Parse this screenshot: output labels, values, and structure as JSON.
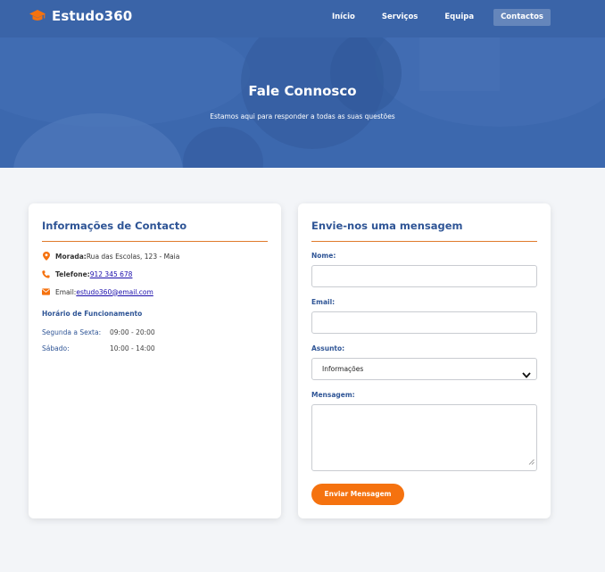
{
  "brand": {
    "name": "Estudo360",
    "icon": "graduation-cap-icon",
    "icon_color": "#f5720f"
  },
  "nav": {
    "items": [
      {
        "label": "Início"
      },
      {
        "label": "Serviços"
      },
      {
        "label": "Equipa"
      },
      {
        "label": "Contactos",
        "active": true
      }
    ]
  },
  "hero": {
    "title": "Fale Connosco",
    "subtitle": "Estamos aqui para responder a todas as suas questões"
  },
  "contact_info": {
    "title": "Informações de Contacto",
    "address_label": "Morada:",
    "address_value": "Rua das Escolas, 123 - Maia",
    "phone_label": "Telefone:",
    "phone_value": "912 345 678",
    "email_label": "Email:",
    "email_value": "estudo360@email.com",
    "hours_title": "Horário de Funcionamento",
    "hours": [
      {
        "day": "Segunda a Sexta:",
        "time": "09:00 - 20:00"
      },
      {
        "day": "Sábado:",
        "time": "10:00 - 14:00"
      }
    ]
  },
  "form": {
    "title": "Envie-nos uma mensagem",
    "name_label": "Nome:",
    "name_value": "",
    "email_label": "Email:",
    "email_value": "",
    "subject_label": "Assunto:",
    "subject_value": "Informações",
    "message_label": "Mensagem:",
    "message_value": "",
    "submit_label": "Enviar Mensagem"
  },
  "colors": {
    "primary": "#3a64a8",
    "accent": "#f5720f",
    "heading": "#2f5596",
    "background": "#f3f5f8"
  }
}
